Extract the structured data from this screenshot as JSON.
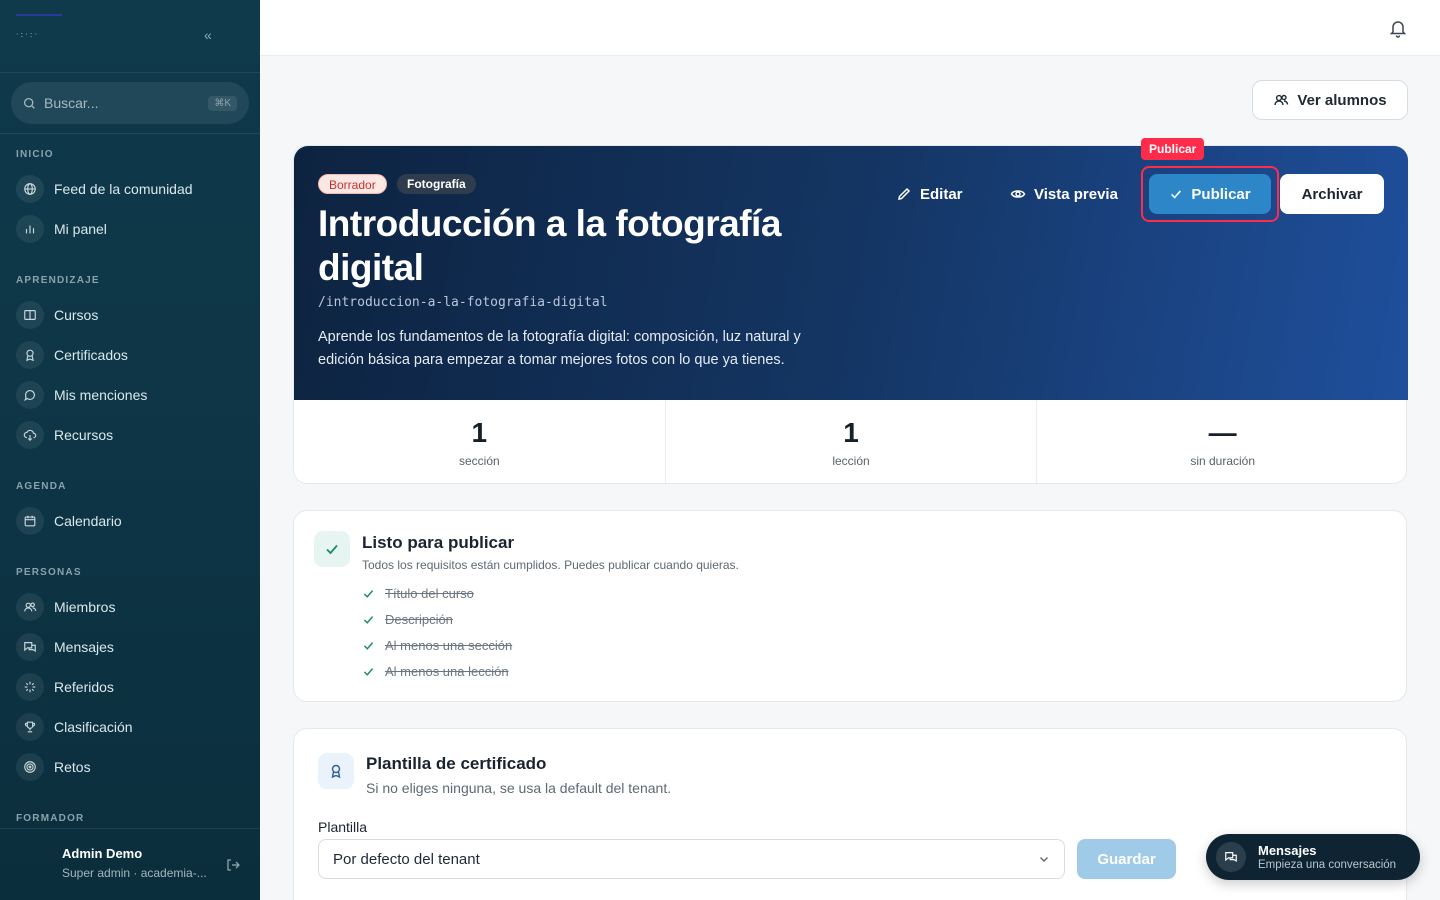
{
  "sidebar": {
    "search_placeholder": "Buscar...",
    "search_shortcut": "⌘K",
    "sections": {
      "inicio": "INICIO",
      "aprendizaje": "APRENDIZAJE",
      "agenda": "AGENDA",
      "personas": "PERSONAS",
      "formador": "FORMADOR"
    },
    "items": {
      "feed": "Feed de la comunidad",
      "panel": "Mi panel",
      "cursos": "Cursos",
      "certificados": "Certificados",
      "menciones": "Mis menciones",
      "recursos": "Recursos",
      "calendario": "Calendario",
      "miembros": "Miembros",
      "mensajes": "Mensajes",
      "referidos": "Referidos",
      "clasificacion": "Clasificación",
      "retos": "Retos"
    },
    "user": {
      "name": "Admin Demo",
      "role": "Super admin · academia-..."
    }
  },
  "header": {
    "ver_alumnos": "Ver alumnos"
  },
  "course": {
    "status_badge": "Borrador",
    "category_badge": "Fotografía",
    "title": "Introducción a la fotografía digital",
    "slug": "/introduccion-a-la-fotografia-digital",
    "description": "Aprende los fundamentos de la fotografía digital: composición, luz natural y edición básica para empezar a tomar mejores fotos con lo que ya tienes.",
    "actions": {
      "edit": "Editar",
      "preview": "Vista previa",
      "publish": "Publicar",
      "publish_tag": "Publicar",
      "archive": "Archivar"
    },
    "stats": [
      {
        "value": "1",
        "label": "sección"
      },
      {
        "value": "1",
        "label": "lección"
      },
      {
        "value": "—",
        "label": "sin duración"
      }
    ]
  },
  "ready": {
    "title": "Listo para publicar",
    "subtitle": "Todos los requisitos están cumplidos. Puedes publicar cuando quieras.",
    "requirements": [
      "Título del curso",
      "Descripción",
      "Al menos una sección",
      "Al menos una lección"
    ]
  },
  "certificate": {
    "title": "Plantilla de certificado",
    "subtitle": "Si no eliges ninguna, se usa la default del tenant.",
    "field_label": "Plantilla",
    "selected": "Por defecto del tenant",
    "save": "Guardar"
  },
  "messages_widget": {
    "title": "Mensajes",
    "subtitle": "Empieza una conversación"
  },
  "colors": {
    "sidebar_bg": "#0f3a4c",
    "primary": "#2d86c8",
    "highlight": "#ff2b4a",
    "success": "#1f8a6a"
  }
}
